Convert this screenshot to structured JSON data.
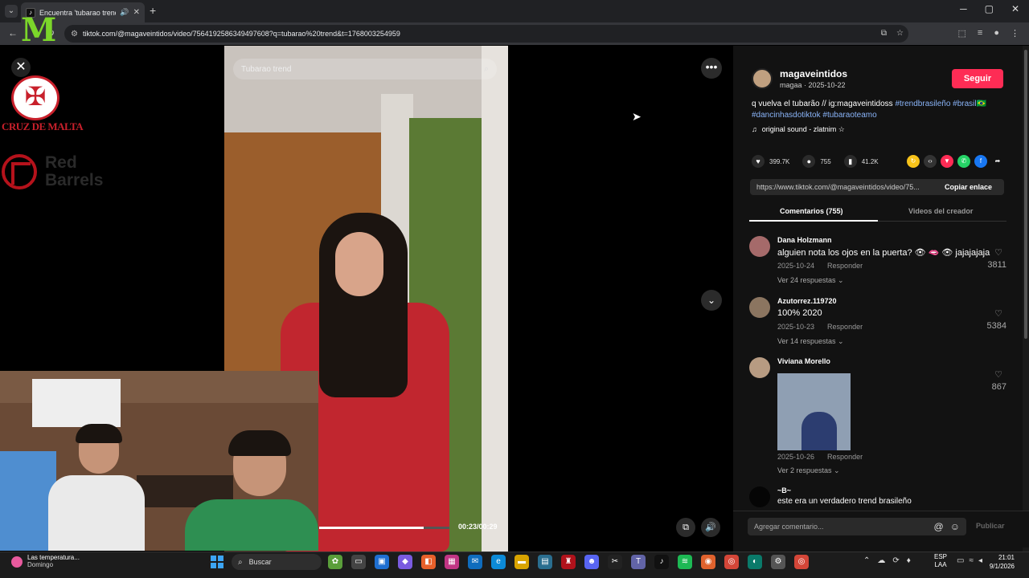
{
  "browser": {
    "tab_title": "Encuentra 'tubarao trend' e",
    "url": "tiktok.com/@magaveintidos/video/7564192586349497608?q=tubarao%20trend&t=1768003254959"
  },
  "overlay": {
    "cruz_text": "CRUZ DE MALTA",
    "redbarrels_text_1": "Red",
    "redbarrels_text_2": "Barrels"
  },
  "video": {
    "search_placeholder": "Tubarao trend",
    "time": "00:23/00:29",
    "progress": 0.8
  },
  "author": {
    "name": "magaveintidos",
    "meta": "magaa · 2025-10-22",
    "follow": "Seguir"
  },
  "caption": {
    "text": "q vuelva el tubarão // ig:magaveintidoss",
    "tag1": "#trendbrasileño",
    "tag2": "#brasil🇧🇷",
    "tag3": "#dancinhasdotiktok",
    "tag4": "#tubaraoteamo"
  },
  "music": "original sound - zlatnim ☆",
  "stats": {
    "likes": "399.7K",
    "comments": "755",
    "saves": "41.2K"
  },
  "link": {
    "url": "https://www.tiktok.com/@magaveintidos/video/75...",
    "copy": "Copiar enlace"
  },
  "tabs": {
    "comments": "Comentarios (755)",
    "creator": "Videos del creador"
  },
  "comments": [
    {
      "user": "Dana Holzmann",
      "text": "alguien nota los ojos en la puerta? 👁 🫦 👁 jajajajaja",
      "date": "2025-10-24",
      "reply": "Responder",
      "replies": "Ver 24 respuestas ⌄",
      "likes": "3811"
    },
    {
      "user": "Azutorrez.119720",
      "text": "100% 2020",
      "date": "2025-10-23",
      "reply": "Responder",
      "replies": "Ver 14 respuestas ⌄",
      "likes": "5384"
    },
    {
      "user": "Viviana Morello",
      "text": "",
      "date": "2025-10-26",
      "reply": "Responder",
      "replies": "Ver 2 respuestas ⌄",
      "likes": "867"
    },
    {
      "user": "~B~",
      "text": "este era un verdadero trend brasileño",
      "date": "",
      "reply": "",
      "replies": "",
      "likes": ""
    }
  ],
  "comment_bar": {
    "placeholder": "Agregar comentario...",
    "publish": "Publicar"
  },
  "taskbar": {
    "weather_title": "Las temperatura...",
    "weather_sub": "Domingo",
    "search": "Buscar",
    "lang_1": "ESP",
    "lang_2": "LAA",
    "time": "21:01",
    "date": "9/1/2026"
  },
  "colors": {
    "accent": "#fe2c55",
    "tag": "#8ab4f8"
  }
}
